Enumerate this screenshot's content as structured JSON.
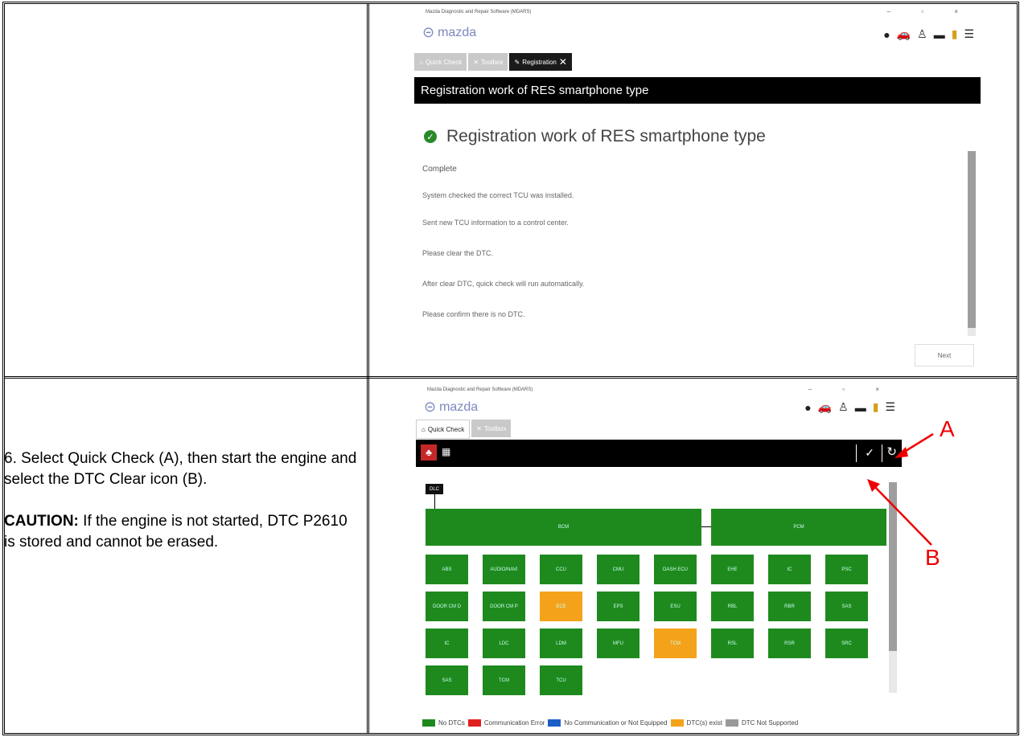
{
  "instructions": {
    "step": "6. Select Quick Check (A), then start the engine and select the DTC Clear icon (B).",
    "caution_label": "CAUTION:",
    "caution_text": " If the engine is not started, DTC P2610 is stored and cannot be erased."
  },
  "screen1": {
    "window_title": "Mazda Diagnostic and Repair Software (MDARS)",
    "logo": "mazda",
    "tabs": [
      {
        "label": "Quick Check",
        "icon": "home-icon"
      },
      {
        "label": "Toolbox",
        "icon": "wrench-icon"
      },
      {
        "label": "Registration",
        "icon": "pencil-icon",
        "active": true
      }
    ],
    "header": "Registration work of RES smartphone type",
    "heading": "Registration work of RES smartphone type",
    "status": "Complete",
    "lines": [
      "System checked the correct TCU was installed.",
      "Sent new TCU information to a control center.",
      "Please clear the DTC.",
      "After clear DTC, quick check will run automatically.",
      "Please confirm there is no DTC."
    ],
    "next_button": "Next"
  },
  "screen2": {
    "window_title": "Mazda Diagnostic and Repair Software (MDARS)",
    "logo": "mazda",
    "tabs": [
      {
        "label": "Quick Check",
        "icon": "home-icon",
        "active": true
      },
      {
        "label": "Toolbox",
        "icon": "wrench-icon"
      }
    ],
    "dlc_label": "DLC",
    "top_modules": [
      "BCM",
      "PCM"
    ],
    "modules": [
      [
        "ABS",
        "AUDIO/NAVI",
        "CCU",
        "CMU",
        "DASH ECU",
        "EHE",
        "IC",
        "PSC"
      ],
      [
        "DOOR CM D",
        "DOOR CM P",
        "ECE",
        "EPS",
        "ESU",
        "RBL",
        "RBR",
        "SAS"
      ],
      [
        "IC",
        "LDC",
        "LDM",
        "MFU",
        "TCM",
        "RSL",
        "RSR",
        "SRC"
      ],
      [
        "SAS",
        "TCM",
        "TCU"
      ]
    ],
    "warn_cells": [
      [
        1,
        2
      ],
      [
        2,
        4
      ]
    ],
    "legend": [
      {
        "label": "No DTCs",
        "color": "#1e8a1e"
      },
      {
        "label": "Communication Error",
        "color": "#e02020"
      },
      {
        "label": "No Communication or Not Equipped",
        "color": "#1a5fc8"
      },
      {
        "label": "DTC(s) exist",
        "color": "#f5a21b"
      },
      {
        "label": "DTC Not Supported",
        "color": "#999999"
      }
    ],
    "annotation_a": "A",
    "annotation_b": "B"
  }
}
